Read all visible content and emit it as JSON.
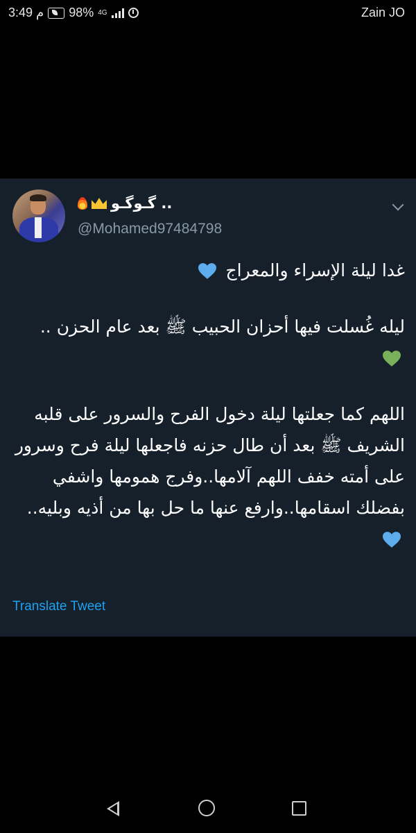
{
  "status_bar": {
    "time": "3:49 م",
    "battery": "98%",
    "network": "4G",
    "carrier": "Zain JO"
  },
  "tweet": {
    "display_name": "گـوگـو ..",
    "name_emojis": [
      "crown-icon",
      "fire-icon"
    ],
    "handle": "@Mohamed97484798",
    "paragraphs": [
      {
        "text": "غدا ليلة الإسراء والمعراج",
        "heart": "blue"
      },
      {
        "text": "ليله غُسلت فيها أحزان الحبيب ﷺ بعد عام الحزن ..",
        "heart": "green"
      },
      {
        "text": "اللهم كما جعلتها ليلة دخول الفرح والسرور على قلبه الشريف ﷺ بعد أن طال حزنه فاجعلها ليلة فرح وسرور على أمته خفف اللهم آلامها..وفرج همومها واشفي بفضلك اسقامها..وارفع عنها ما حل بها من أذيه وبليه..",
        "heart": "blue"
      }
    ],
    "translate_label": "Translate Tweet"
  },
  "colors": {
    "card_bg": "#15202b",
    "handle": "#8899a6",
    "link": "#1da1f2",
    "heart_blue": "#5dadec",
    "heart_green": "#78b159"
  },
  "nav_bar": {
    "icons": [
      "back-icon",
      "home-icon",
      "recent-apps-icon"
    ]
  }
}
